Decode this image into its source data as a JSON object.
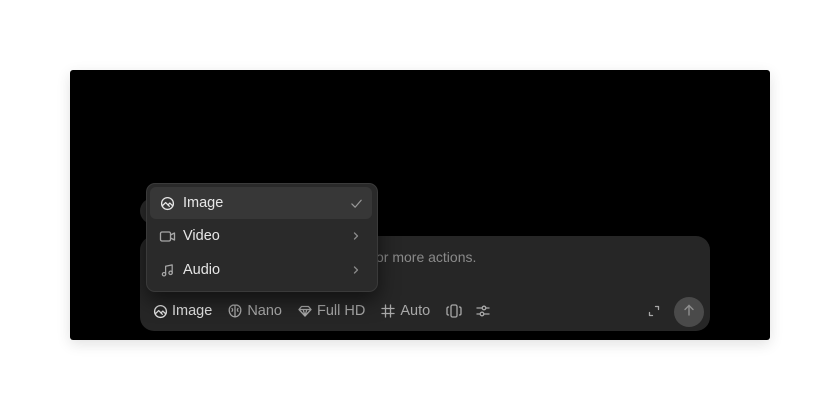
{
  "composer": {
    "placeholder_tail": "or more actions.",
    "toolbar": {
      "mode": {
        "label": "Image",
        "icon": "image-icon"
      },
      "model": {
        "label": "Nano",
        "icon": "model-brain-icon"
      },
      "quality": {
        "label": "Full HD",
        "icon": "diamond-icon"
      },
      "aspect": {
        "label": "Auto",
        "icon": "hash-icon"
      },
      "variations": {
        "icon": "variations-icon"
      },
      "settings": {
        "icon": "sliders-icon"
      }
    },
    "expand": {
      "icon": "expand-icon"
    },
    "send": {
      "icon": "arrow-up-icon"
    }
  },
  "mode_menu": {
    "items": [
      {
        "label": "Image",
        "icon": "image-icon",
        "selected": true,
        "trailing": "check-icon"
      },
      {
        "label": "Video",
        "icon": "video-icon",
        "selected": false,
        "trailing": "chevron-right-icon"
      },
      {
        "label": "Audio",
        "icon": "music-icon",
        "selected": false,
        "trailing": "chevron-right-icon"
      }
    ]
  },
  "colors": {
    "canvas": "#000000",
    "composer_bg": "#262626",
    "menu_bg": "#2a2a2a",
    "menu_selected": "#373737",
    "send_button": "#4a4a4a"
  }
}
